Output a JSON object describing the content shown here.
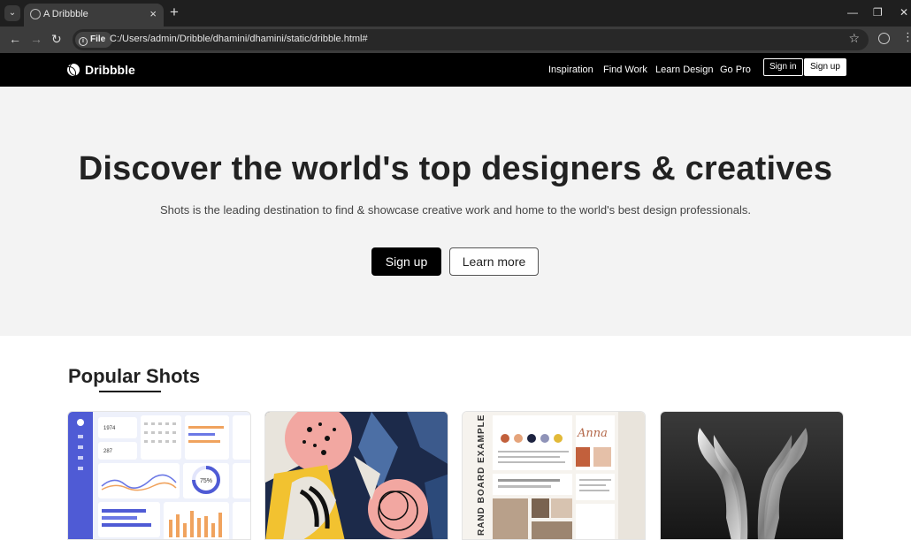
{
  "browser": {
    "tab_title": "A Dribbble",
    "tab_close": "×",
    "new_tab": "+",
    "file_chip": "File",
    "url": "C:/Users/admin/Dribble/dhamini/dhamini/static/dribble.html#"
  },
  "header": {
    "logo": "Dribbble",
    "nav": [
      "Inspiration",
      "Find Work",
      "Learn Design",
      "Go Pro"
    ],
    "sign_in": "Sign in",
    "sign_up": "Sign up"
  },
  "hero": {
    "title": "Discover the world's top designers & creatives",
    "subtitle": "Shots is the leading destination to find & showcase creative work and home to the world's best design professionals.",
    "primary_button": "Sign up",
    "secondary_button": "Learn more"
  },
  "popular": {
    "title": "Popular Shots",
    "shots": [
      {
        "name": "dashboard-ui-shot",
        "card_text": [
          "1974",
          "287",
          "75%"
        ]
      },
      {
        "name": "abstract-art-shot"
      },
      {
        "name": "brand-board-shot",
        "vertical_text": "RAND BOARD EXAMPLE",
        "script_text": "Anna"
      },
      {
        "name": "metallic-logo-shot"
      }
    ]
  },
  "colors": {
    "header_bg": "#000000",
    "hero_bg": "#f3f3f3",
    "text_dark": "#222222"
  }
}
